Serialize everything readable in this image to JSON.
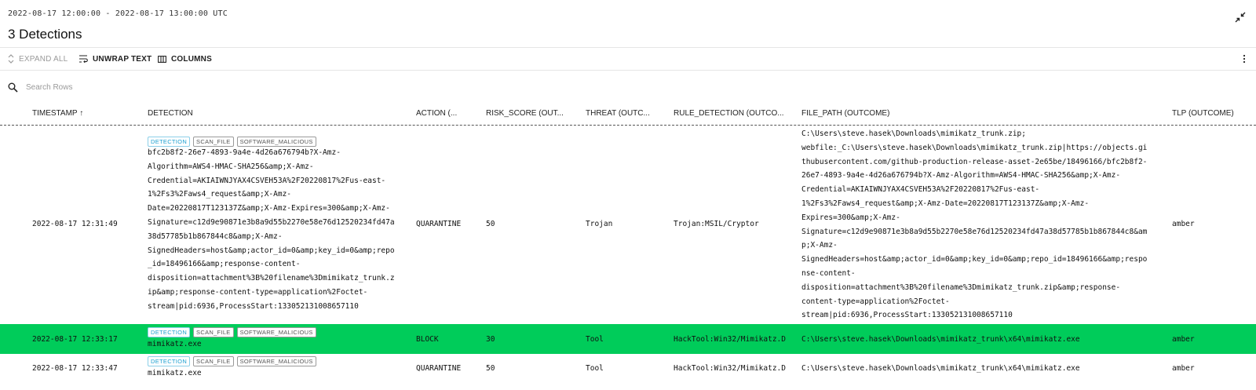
{
  "time_range": "2022-08-17 12:00:00 - 2022-08-17 13:00:00 UTC",
  "title": "3 Detections",
  "toolbar": {
    "expand_all": "EXPAND ALL",
    "unwrap_text": "UNWRAP TEXT",
    "columns": "COLUMNS"
  },
  "search": {
    "placeholder": "Search Rows"
  },
  "columns": {
    "timestamp": "TIMESTAMP ↑",
    "detection": "DETECTION",
    "action": "ACTION (...",
    "risk": "RISK_SCORE (OUT...",
    "threat": "THREAT (OUTC...",
    "rule": "RULE_DETECTION (OUTCO...",
    "file_path": "FILE_PATH (OUTCOME)",
    "tlp": "TLP (OUTCOME)"
  },
  "accent_colors": {
    "selected_row": "#00cc5a",
    "tag_primary": "#1a9fd0"
  },
  "rows": [
    {
      "timestamp": "2022-08-17 12:31:49",
      "tags": [
        "DETECTION",
        "SCAN_FILE",
        "SOFTWARE_MALICIOUS"
      ],
      "detection": "bfc2b8f2-26e7-4893-9a4e-4d26a676794b?X-Amz-\nAlgorithm=AWS4-HMAC-SHA256&amp;X-Amz-\nCredential=AKIAIWNJYAX4CSVEH53A%2F20220817%2Fus-east-\n1%2Fs3%2Faws4_request&amp;X-Amz-\nDate=20220817T123137Z&amp;X-Amz-Expires=300&amp;X-Amz-\nSignature=c12d9e90871e3b8a9d55b2270e58e76d12520234fd47a\n38d57785b1b867844c8&amp;X-Amz-\nSignedHeaders=host&amp;actor_id=0&amp;key_id=0&amp;repo\n_id=18496166&amp;response-content-\ndisposition=attachment%3B%20filename%3Dmimikatz_trunk.z\nip&amp;response-content-type=application%2Foctet-\nstream|pid:6936,ProcessStart:133052131008657110",
      "action": "QUARANTINE",
      "risk": "50",
      "threat": "Trojan",
      "rule": "Trojan:MSIL/Cryptor",
      "file_path": "C:\\Users\\steve.hasek\\Downloads\\mimikatz_trunk.zip;\nwebfile:_C:\\Users\\steve.hasek\\Downloads\\mimikatz_trunk.zip|https://objects.gi\nthubusercontent.com/github-production-release-asset-2e65be/18496166/bfc2b8f2-\n26e7-4893-9a4e-4d26a676794b?X-Amz-Algorithm=AWS4-HMAC-SHA256&amp;X-Amz-\nCredential=AKIAIWNJYAX4CSVEH53A%2F20220817%2Fus-east-\n1%2Fs3%2Faws4_request&amp;X-Amz-Date=20220817T123137Z&amp;X-Amz-\nExpires=300&amp;X-Amz-\nSignature=c12d9e90871e3b8a9d55b2270e58e76d12520234fd47a38d57785b1b867844c8&am\np;X-Amz-\nSignedHeaders=host&amp;actor_id=0&amp;key_id=0&amp;repo_id=18496166&amp;respo\nnse-content-\ndisposition=attachment%3B%20filename%3Dmimikatz_trunk.zip&amp;response-\ncontent-type=application%2Foctet-\nstream|pid:6936,ProcessStart:133052131008657110",
      "tlp": "amber"
    },
    {
      "timestamp": "2022-08-17 12:33:17",
      "tags": [
        "DETECTION",
        "SCAN_FILE",
        "SOFTWARE_MALICIOUS"
      ],
      "detection": "mimikatz.exe",
      "action": "BLOCK",
      "risk": "30",
      "threat": "Tool",
      "rule": "HackTool:Win32/Mimikatz.D",
      "file_path": "C:\\Users\\steve.hasek\\Downloads\\mimikatz_trunk\\x64\\mimikatz.exe",
      "tlp": "amber"
    },
    {
      "timestamp": "2022-08-17 12:33:47",
      "tags": [
        "DETECTION",
        "SCAN_FILE",
        "SOFTWARE_MALICIOUS"
      ],
      "detection": "mimikatz.exe",
      "action": "QUARANTINE",
      "risk": "50",
      "threat": "Tool",
      "rule": "HackTool:Win32/Mimikatz.D",
      "file_path": "C:\\Users\\steve.hasek\\Downloads\\mimikatz_trunk\\x64\\mimikatz.exe",
      "tlp": "amber"
    }
  ]
}
